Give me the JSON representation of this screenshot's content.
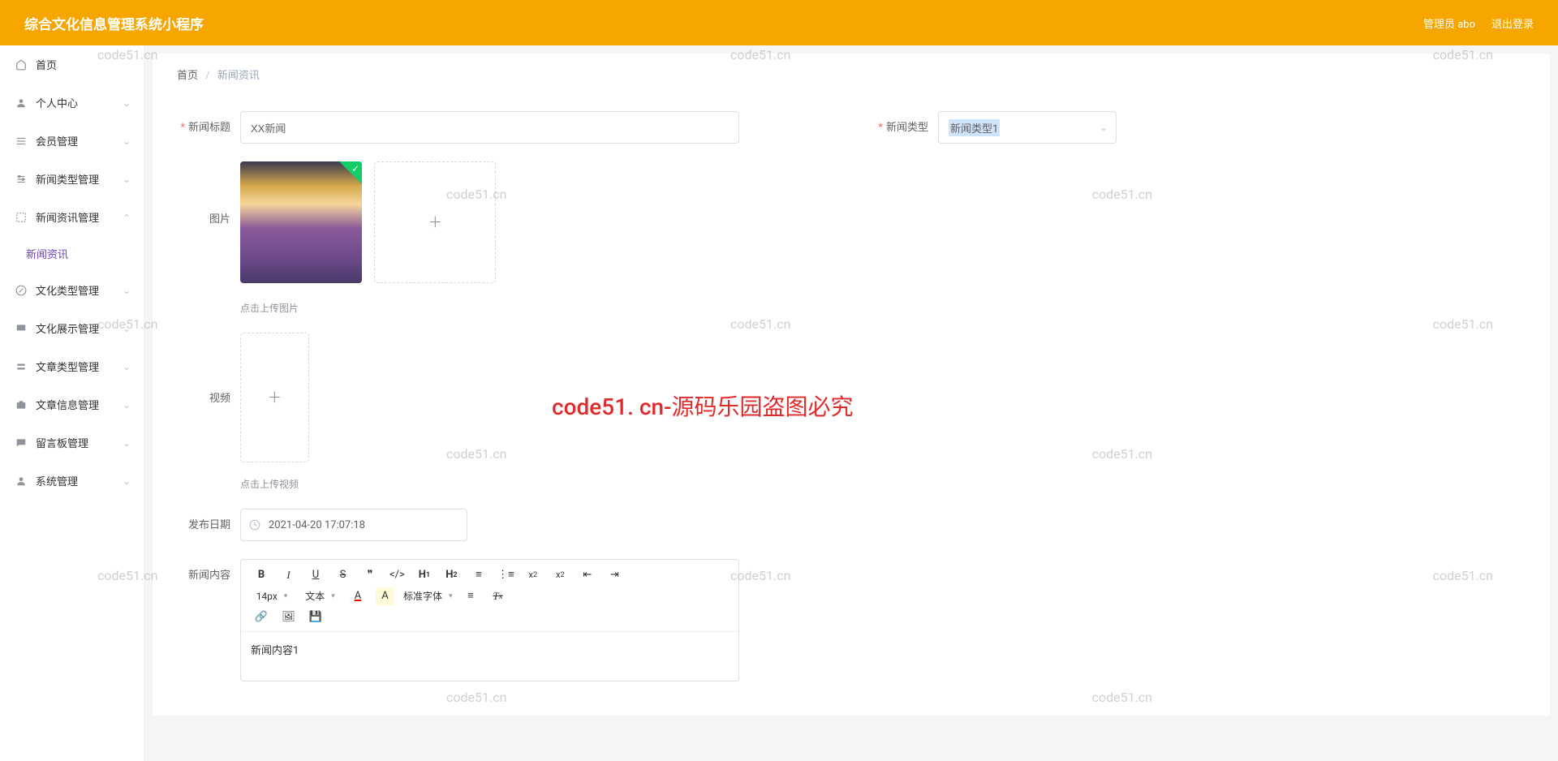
{
  "header": {
    "title": "综合文化信息管理系统小程序",
    "admin_label": "管理员 abo",
    "logout_label": "退出登录"
  },
  "sidebar": {
    "items": [
      {
        "label": "首页",
        "icon": "home"
      },
      {
        "label": "个人中心",
        "icon": "user"
      },
      {
        "label": "会员管理",
        "icon": "list"
      },
      {
        "label": "新闻类型管理",
        "icon": "sliders"
      },
      {
        "label": "新闻资讯管理",
        "icon": "expand",
        "expanded": true,
        "children": [
          {
            "label": "新闻资讯"
          }
        ]
      },
      {
        "label": "文化类型管理",
        "icon": "compass"
      },
      {
        "label": "文化展示管理",
        "icon": "monitor"
      },
      {
        "label": "文章类型管理",
        "icon": "tag"
      },
      {
        "label": "文章信息管理",
        "icon": "briefcase"
      },
      {
        "label": "留言板管理",
        "icon": "message"
      },
      {
        "label": "系统管理",
        "icon": "user-cog"
      }
    ]
  },
  "breadcrumb": {
    "root": "首页",
    "current": "新闻资讯"
  },
  "form": {
    "title_label": "新闻标题",
    "title_value": "XX新闻",
    "type_label": "新闻类型",
    "type_value": "新闻类型1",
    "image_label": "图片",
    "image_tip": "点击上传图片",
    "video_label": "视频",
    "video_tip": "点击上传视频",
    "date_label": "发布日期",
    "date_value": "2021-04-20 17:07:18",
    "content_label": "新闻内容",
    "content_value": "新闻内容1",
    "editor": {
      "font_size": "14px",
      "font_style": "文本",
      "font_family": "标准字体"
    }
  },
  "watermark_text": "code51.cn",
  "watermark_red": "code51. cn-源码乐园盗图必究"
}
